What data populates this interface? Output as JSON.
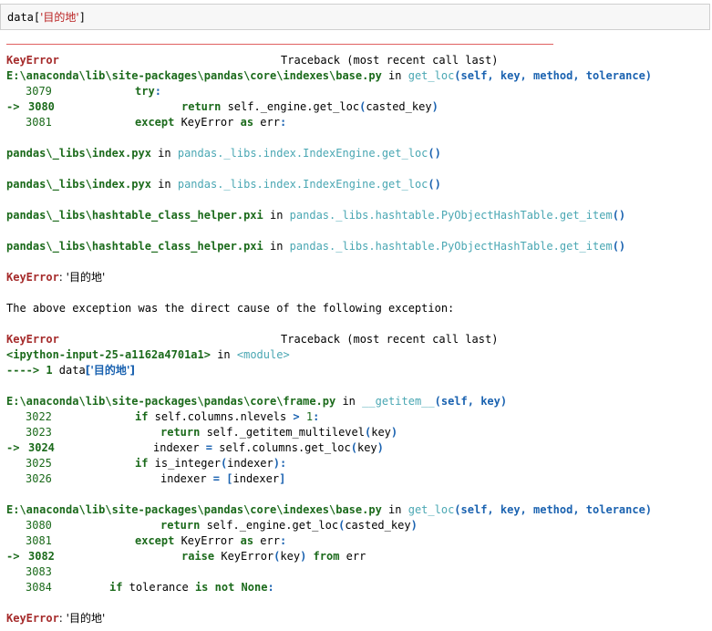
{
  "input": {
    "code_prefix": "data[",
    "code_string": "'目的地'",
    "code_suffix": "]"
  },
  "tb1": {
    "error_name": "KeyError",
    "traceback_header": "Traceback (most recent call last)",
    "frame1": {
      "file": "E:\\anaconda\\lib\\site-packages\\pandas\\core\\indexes\\base.py",
      "in": " in ",
      "func": "get_loc",
      "args": "(self, key, method, tolerance)",
      "lines": [
        {
          "num": "3079",
          "prefix": "",
          "code": "try:"
        },
        {
          "num": "3080",
          "prefix": "-> ",
          "code": "return self._engine.get_loc(casted_key)"
        },
        {
          "num": "3081",
          "prefix": "",
          "code": "except KeyError as err:"
        }
      ]
    },
    "frame2": {
      "file": "pandas\\_libs\\index.pyx",
      "in": " in ",
      "func": "pandas._libs.index.IndexEngine.get_loc",
      "args": "()"
    },
    "frame3": {
      "file": "pandas\\_libs\\index.pyx",
      "in": " in ",
      "func": "pandas._libs.index.IndexEngine.get_loc",
      "args": "()"
    },
    "frame4": {
      "file": "pandas\\_libs\\hashtable_class_helper.pxi",
      "in": " in ",
      "func": "pandas._libs.hashtable.PyObjectHashTable.get_item",
      "args": "()"
    },
    "frame5": {
      "file": "pandas\\_libs\\hashtable_class_helper.pxi",
      "in": " in ",
      "func": "pandas._libs.hashtable.PyObjectHashTable.get_item",
      "args": "()"
    },
    "error_line": {
      "name": "KeyError",
      "message": ": '目的地'"
    }
  },
  "cause_text": "The above exception was the direct cause of the following exception:",
  "tb2": {
    "error_name": "KeyError",
    "traceback_header": "Traceback (most recent call last)",
    "frame1": {
      "file": "<ipython-input-25-a1162a4701a1>",
      "in": " in ",
      "func": "<module>",
      "arrow": "----> 1 ",
      "code_prefix": "data",
      "code_string": "['目的地']"
    },
    "frame2": {
      "file": "E:\\anaconda\\lib\\site-packages\\pandas\\core\\frame.py",
      "in": " in ",
      "func": "__getitem__",
      "args": "(self, key)",
      "lines": [
        {
          "num": "3022",
          "prefix": "",
          "code": "    if self.columns.nlevels > 1:"
        },
        {
          "num": "3023",
          "prefix": "",
          "code": "        return self._getitem_multilevel(key)"
        },
        {
          "num": "3024",
          "prefix": "-> ",
          "code": "       indexer = self.columns.get_loc(key)"
        },
        {
          "num": "3025",
          "prefix": "",
          "code": "    if is_integer(indexer):"
        },
        {
          "num": "3026",
          "prefix": "",
          "code": "        indexer = [indexer]"
        }
      ]
    },
    "frame3": {
      "file": "E:\\anaconda\\lib\\site-packages\\pandas\\core\\indexes\\base.py",
      "in": " in ",
      "func": "get_loc",
      "args": "(self, key, method, tolerance)",
      "lines": [
        {
          "num": "3080",
          "prefix": "",
          "code": "        return self._engine.get_loc(casted_key)"
        },
        {
          "num": "3081",
          "prefix": "",
          "code": "    except KeyError as err:"
        },
        {
          "num": "3082",
          "prefix": "-> ",
          "code": "        raise KeyError(key) from err"
        },
        {
          "num": "3083",
          "prefix": "",
          "code": ""
        },
        {
          "num": "3084",
          "prefix": "",
          "code": "  if tolerance is not None:"
        }
      ]
    },
    "error_line": {
      "name": "KeyError",
      "message": ": '目的地'"
    }
  }
}
